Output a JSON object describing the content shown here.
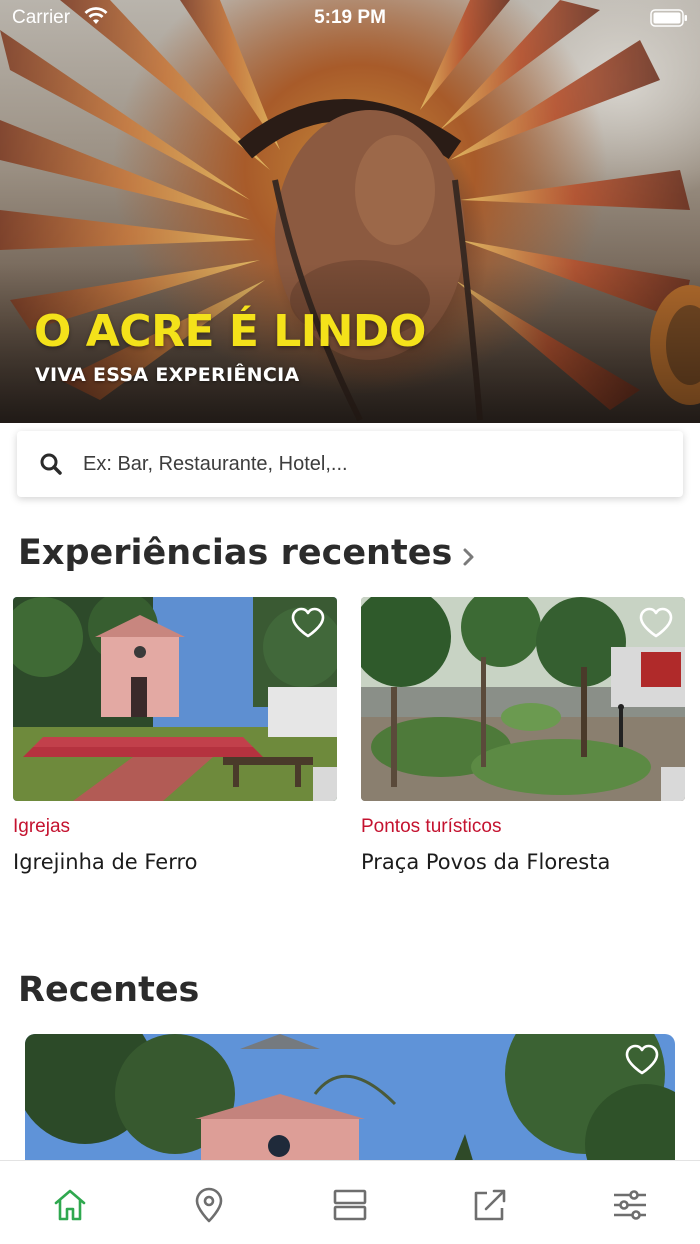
{
  "status_bar": {
    "carrier": "Carrier",
    "time": "5:19 PM"
  },
  "hero": {
    "title": "O ACRE É LINDO",
    "subtitle": "VIVA ESSA EXPERIÊNCIA",
    "title_color": "#f4e21a"
  },
  "search": {
    "placeholder": "Ex: Bar, Restaurante, Hotel,...",
    "value": "",
    "icon": "search-icon"
  },
  "experiences": {
    "title": "Experiências recentes",
    "items": [
      {
        "category": "Igrejas",
        "name": "Igrejinha de Ferro",
        "icon": "heart-icon"
      },
      {
        "category": "Pontos turísticos",
        "name": "Praça Povos da Floresta",
        "icon": "heart-icon"
      }
    ]
  },
  "recent": {
    "title": "Recentes"
  },
  "tab_bar": {
    "active_color": "#2fa84f",
    "inactive_color": "#6e6e6e",
    "tabs": [
      {
        "icon": "home-icon",
        "active": true
      },
      {
        "icon": "map-pin-icon",
        "active": false
      },
      {
        "icon": "list-icon",
        "active": false
      },
      {
        "icon": "share-icon",
        "active": false
      },
      {
        "icon": "sliders-icon",
        "active": false
      }
    ]
  },
  "colors": {
    "category_red": "#c4122f",
    "heading": "#2b2b2b"
  }
}
